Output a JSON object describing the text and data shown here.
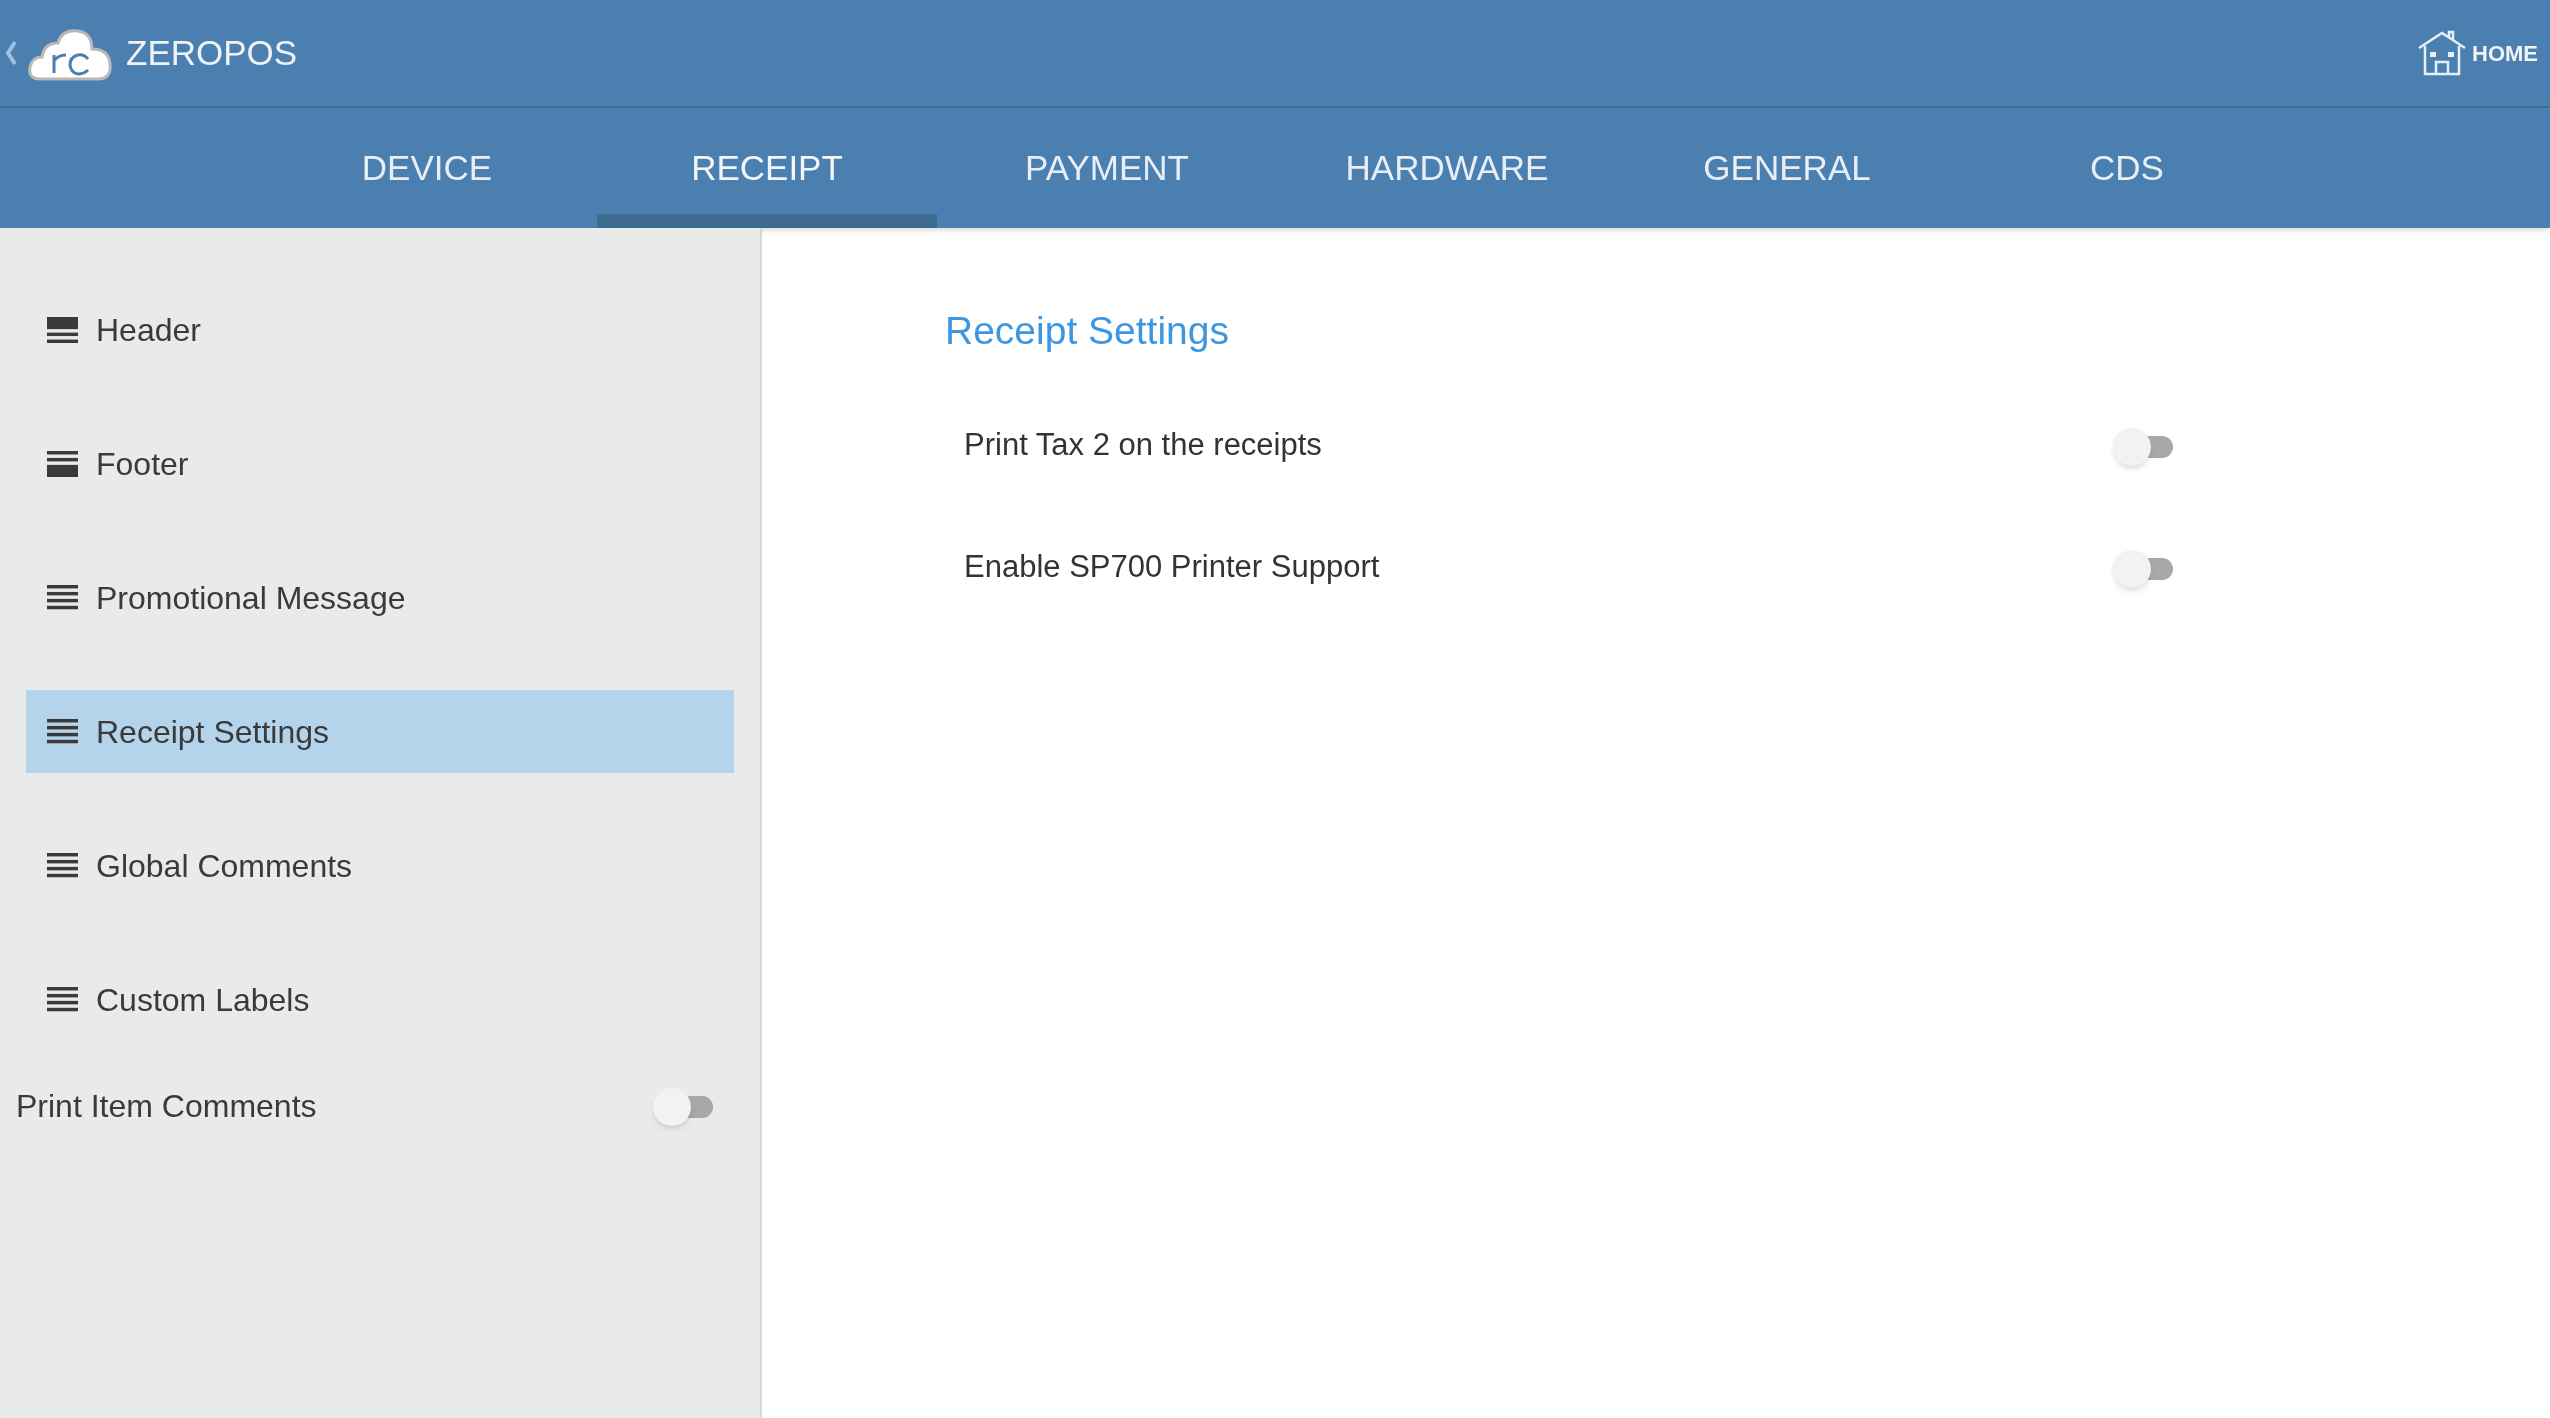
{
  "app_bar": {
    "title": "ZEROPOS",
    "home_label": "HOME"
  },
  "tabs": [
    {
      "label": "DEVICE",
      "selected": false
    },
    {
      "label": "RECEIPT",
      "selected": true
    },
    {
      "label": "PAYMENT",
      "selected": false
    },
    {
      "label": "HARDWARE",
      "selected": false
    },
    {
      "label": "GENERAL",
      "selected": false
    },
    {
      "label": "CDS",
      "selected": false
    }
  ],
  "sidebar": {
    "items": [
      {
        "label": "Header",
        "kind": "header",
        "selected": false
      },
      {
        "label": "Footer",
        "kind": "footer",
        "selected": false
      },
      {
        "label": "Promotional Message",
        "kind": "list",
        "selected": false
      },
      {
        "label": "Receipt Settings",
        "kind": "list",
        "selected": true
      },
      {
        "label": "Global Comments",
        "kind": "list",
        "selected": false
      },
      {
        "label": "Custom Labels",
        "kind": "list",
        "selected": false
      }
    ],
    "toggle": {
      "label": "Print Item Comments",
      "on": false
    }
  },
  "content": {
    "title": "Receipt Settings",
    "settings": [
      {
        "label": "Print Tax 2 on the receipts",
        "on": false
      },
      {
        "label": "Enable SP700 Printer Support",
        "on": false
      }
    ]
  }
}
